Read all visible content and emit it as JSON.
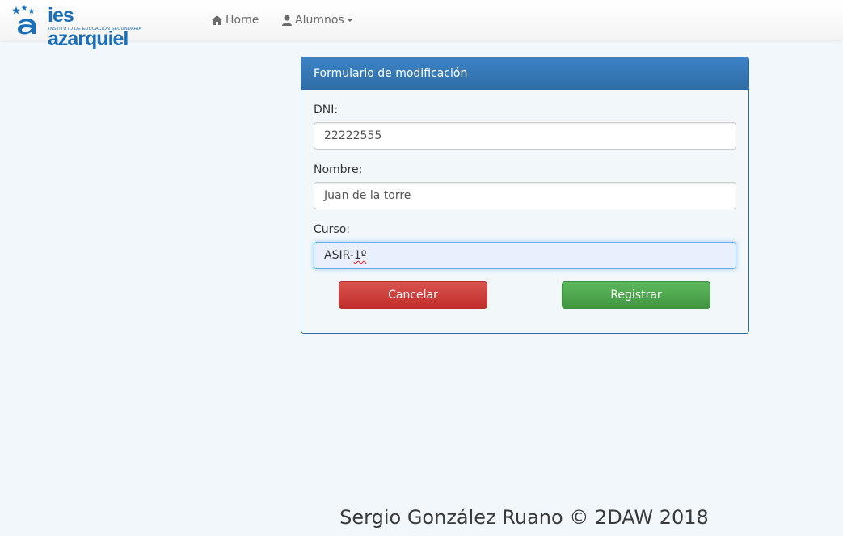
{
  "brand": {
    "name": "ies azarquiel",
    "subtitle": "INSTITUTO DE EDUCACIÓN SECUNDARIA",
    "color": "#1a6fb8"
  },
  "nav": {
    "home": {
      "label": "Home",
      "icon": "home-icon"
    },
    "alumnos": {
      "label": "Alumnos",
      "icon": "user-icon"
    }
  },
  "form": {
    "title": "Formulario de modificación",
    "dni": {
      "label": "DNI:",
      "value": "22222555"
    },
    "nombre": {
      "label": "Nombre:",
      "value": "Juan de la torre"
    },
    "curso": {
      "label": "Curso:",
      "value_prefix": "ASIR-",
      "value_suffix": "1º"
    },
    "cancel_label": "Cancelar",
    "submit_label": "Registrar"
  },
  "colors": {
    "panel_primary": "#337ab7",
    "danger": "#d9534f",
    "success": "#5cb85c"
  },
  "footer": {
    "text": "Sergio González Ruano © 2DAW 2018"
  }
}
